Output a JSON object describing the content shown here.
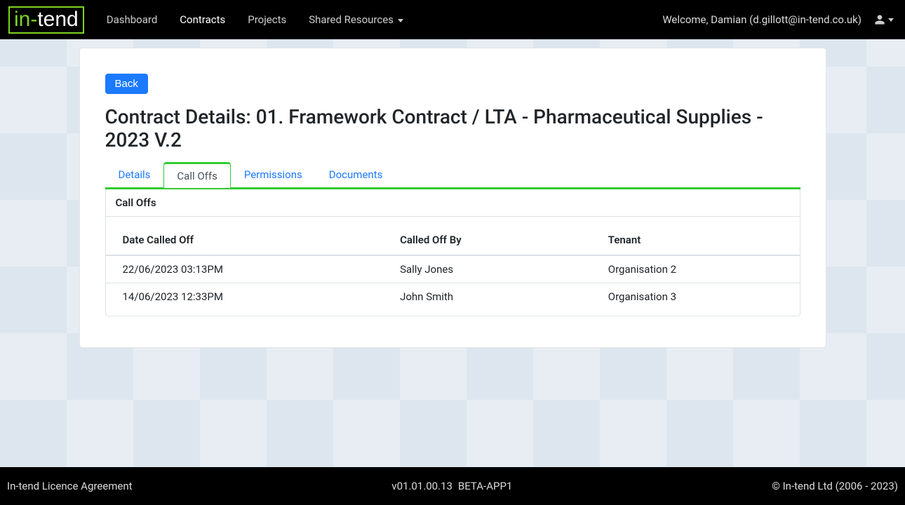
{
  "header": {
    "logo_prefix": "in-",
    "logo_suffix": "tend",
    "nav": {
      "dashboard": "Dashboard",
      "contracts": "Contracts",
      "projects": "Projects",
      "shared_resources": "Shared Resources"
    },
    "welcome": "Welcome, Damian (d.gillott@in-tend.co.uk)"
  },
  "page": {
    "back_label": "Back",
    "title": "Contract Details: 01. Framework Contract / LTA - Pharmaceutical Supplies - 2023 V.2",
    "tabs": {
      "details": "Details",
      "call_offs": "Call Offs",
      "permissions": "Permissions",
      "documents": "Documents"
    },
    "panel_title": "Call Offs",
    "table": {
      "columns": {
        "date": "Date Called Off",
        "by": "Called Off By",
        "tenant": "Tenant"
      },
      "rows": [
        {
          "date": "22/06/2023 03:13PM",
          "by": "Sally Jones",
          "tenant": "Organisation 2"
        },
        {
          "date": "14/06/2023 12:33PM",
          "by": "John Smith",
          "tenant": "Organisation 3"
        }
      ]
    }
  },
  "footer": {
    "licence": "In-tend Licence Agreement",
    "version": "v01.01.00.13",
    "env": "BETA-APP1",
    "copyright": "© In-tend Ltd (2006 - 2023)"
  }
}
